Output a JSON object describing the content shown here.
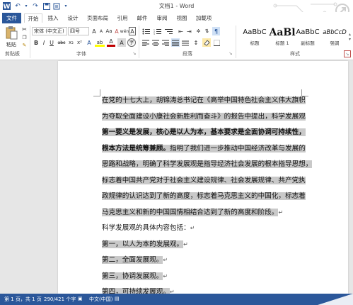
{
  "window": {
    "title": "文档1 - Word"
  },
  "quick_access": {
    "icons": [
      "word-logo-icon",
      "save-icon",
      "undo-icon",
      "redo-icon",
      "print-preview-icon",
      "customize-icon"
    ]
  },
  "tabs": [
    "文件",
    "开始",
    "插入",
    "设计",
    "页面布局",
    "引用",
    "邮件",
    "审阅",
    "视图",
    "加载项"
  ],
  "ribbon": {
    "clipboard": {
      "label": "剪贴板",
      "paste": "粘贴"
    },
    "font": {
      "label": "字体",
      "font_name": "宋体 (中文正)",
      "font_size": "四号",
      "bold": "B",
      "italic": "I",
      "underline": "U",
      "strike": "abc",
      "sub": "x₂",
      "sup": "x²",
      "grow": "A",
      "shrink": "A",
      "case": "Aa",
      "clear": "A",
      "wen": "wén",
      "border_a": "A",
      "highlight": "ab",
      "color_a": "A",
      "shade_a": "A",
      "circle": "字"
    },
    "paragraph": {
      "label": "段落"
    },
    "styles": {
      "label": "样式",
      "items": [
        {
          "sample": "AaBbC",
          "name": "标题"
        },
        {
          "sample": "AaBl",
          "name": "标题 1"
        },
        {
          "sample": "AaBbC",
          "name": "副标题"
        },
        {
          "sample": "aBbCcD",
          "name": "强调"
        }
      ]
    }
  },
  "document": {
    "lines": [
      {
        "text": "在党的十七大上，胡锦涛总书记在《高举中国特色社会主义伟大旗帜",
        "bold": false,
        "mark": ""
      },
      {
        "text": "为夺取全面建设小康社会新胜利而奋斗》的报告中提出，科学发展观",
        "bold": false,
        "mark": ""
      },
      {
        "text": "第一要义是发展，核心是以人为本，基本要求是全面协调可持续性，",
        "bold": true,
        "mark": ""
      },
      {
        "text": "根本方法是统筹兼顾。",
        "bold": true,
        "tail": "指明了我们进一步推动中国经济改革与发展的",
        "mark": ""
      },
      {
        "text": "思路和战略，明确了科学发展观是指导经济社会发展的根本指导思想，",
        "bold": false,
        "mark": ""
      },
      {
        "text": "标志着中国共产党对于社会主义建设规律、社会发展规律、共产党执",
        "bold": false,
        "mark": ""
      },
      {
        "text": "政规律的认识达到了新的高度，标志着马克思主义的中国化，标志着",
        "bold": false,
        "mark": ""
      },
      {
        "text": "马克思主义和新的中国国情相结合达到了新的高度和阶段。",
        "bold": false,
        "mark": "↵"
      },
      {
        "text": "科学发展观的具体内容包括：",
        "bold": false,
        "mark": "↵",
        "nohl": true
      },
      {
        "text": "第一，以人为本的发展观。",
        "bold": false,
        "mark": "↵"
      },
      {
        "text": "第二，全面发展观。",
        "bold": false,
        "mark": "↵"
      },
      {
        "text": "第三，协调发展观。",
        "bold": false,
        "mark": "↵"
      },
      {
        "text": "第四，可持续发展观。",
        "bold": false,
        "mark": "↵"
      }
    ]
  },
  "status": {
    "page": "第 1 页，共 1 页",
    "words": "290/421 个字",
    "lang": "中文(中国)"
  },
  "colors": {
    "accent": "#2b579a",
    "highlight": "#c9c9c9"
  }
}
